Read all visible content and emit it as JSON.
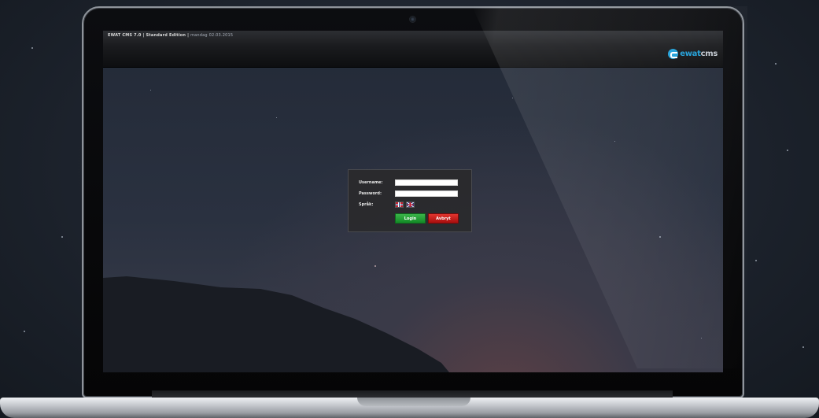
{
  "header": {
    "app_title": "EWAT CMS 7.0 | Standard Edition |",
    "date_text": "mandag 02.03.2015"
  },
  "logo": {
    "text_accent": "ewat",
    "text_main": "cms"
  },
  "login": {
    "username_label": "Username:",
    "password_label": "Password:",
    "language_label": "Språk:",
    "username_value": "",
    "password_value": "",
    "login_button": "Login",
    "cancel_button": "Avbryt",
    "languages": [
      "norwegian-flag-icon",
      "british-flag-icon"
    ]
  },
  "colors": {
    "login_green": "#1f9f33",
    "cancel_red": "#c41c1c",
    "brand_blue": "#1f9fd8"
  }
}
